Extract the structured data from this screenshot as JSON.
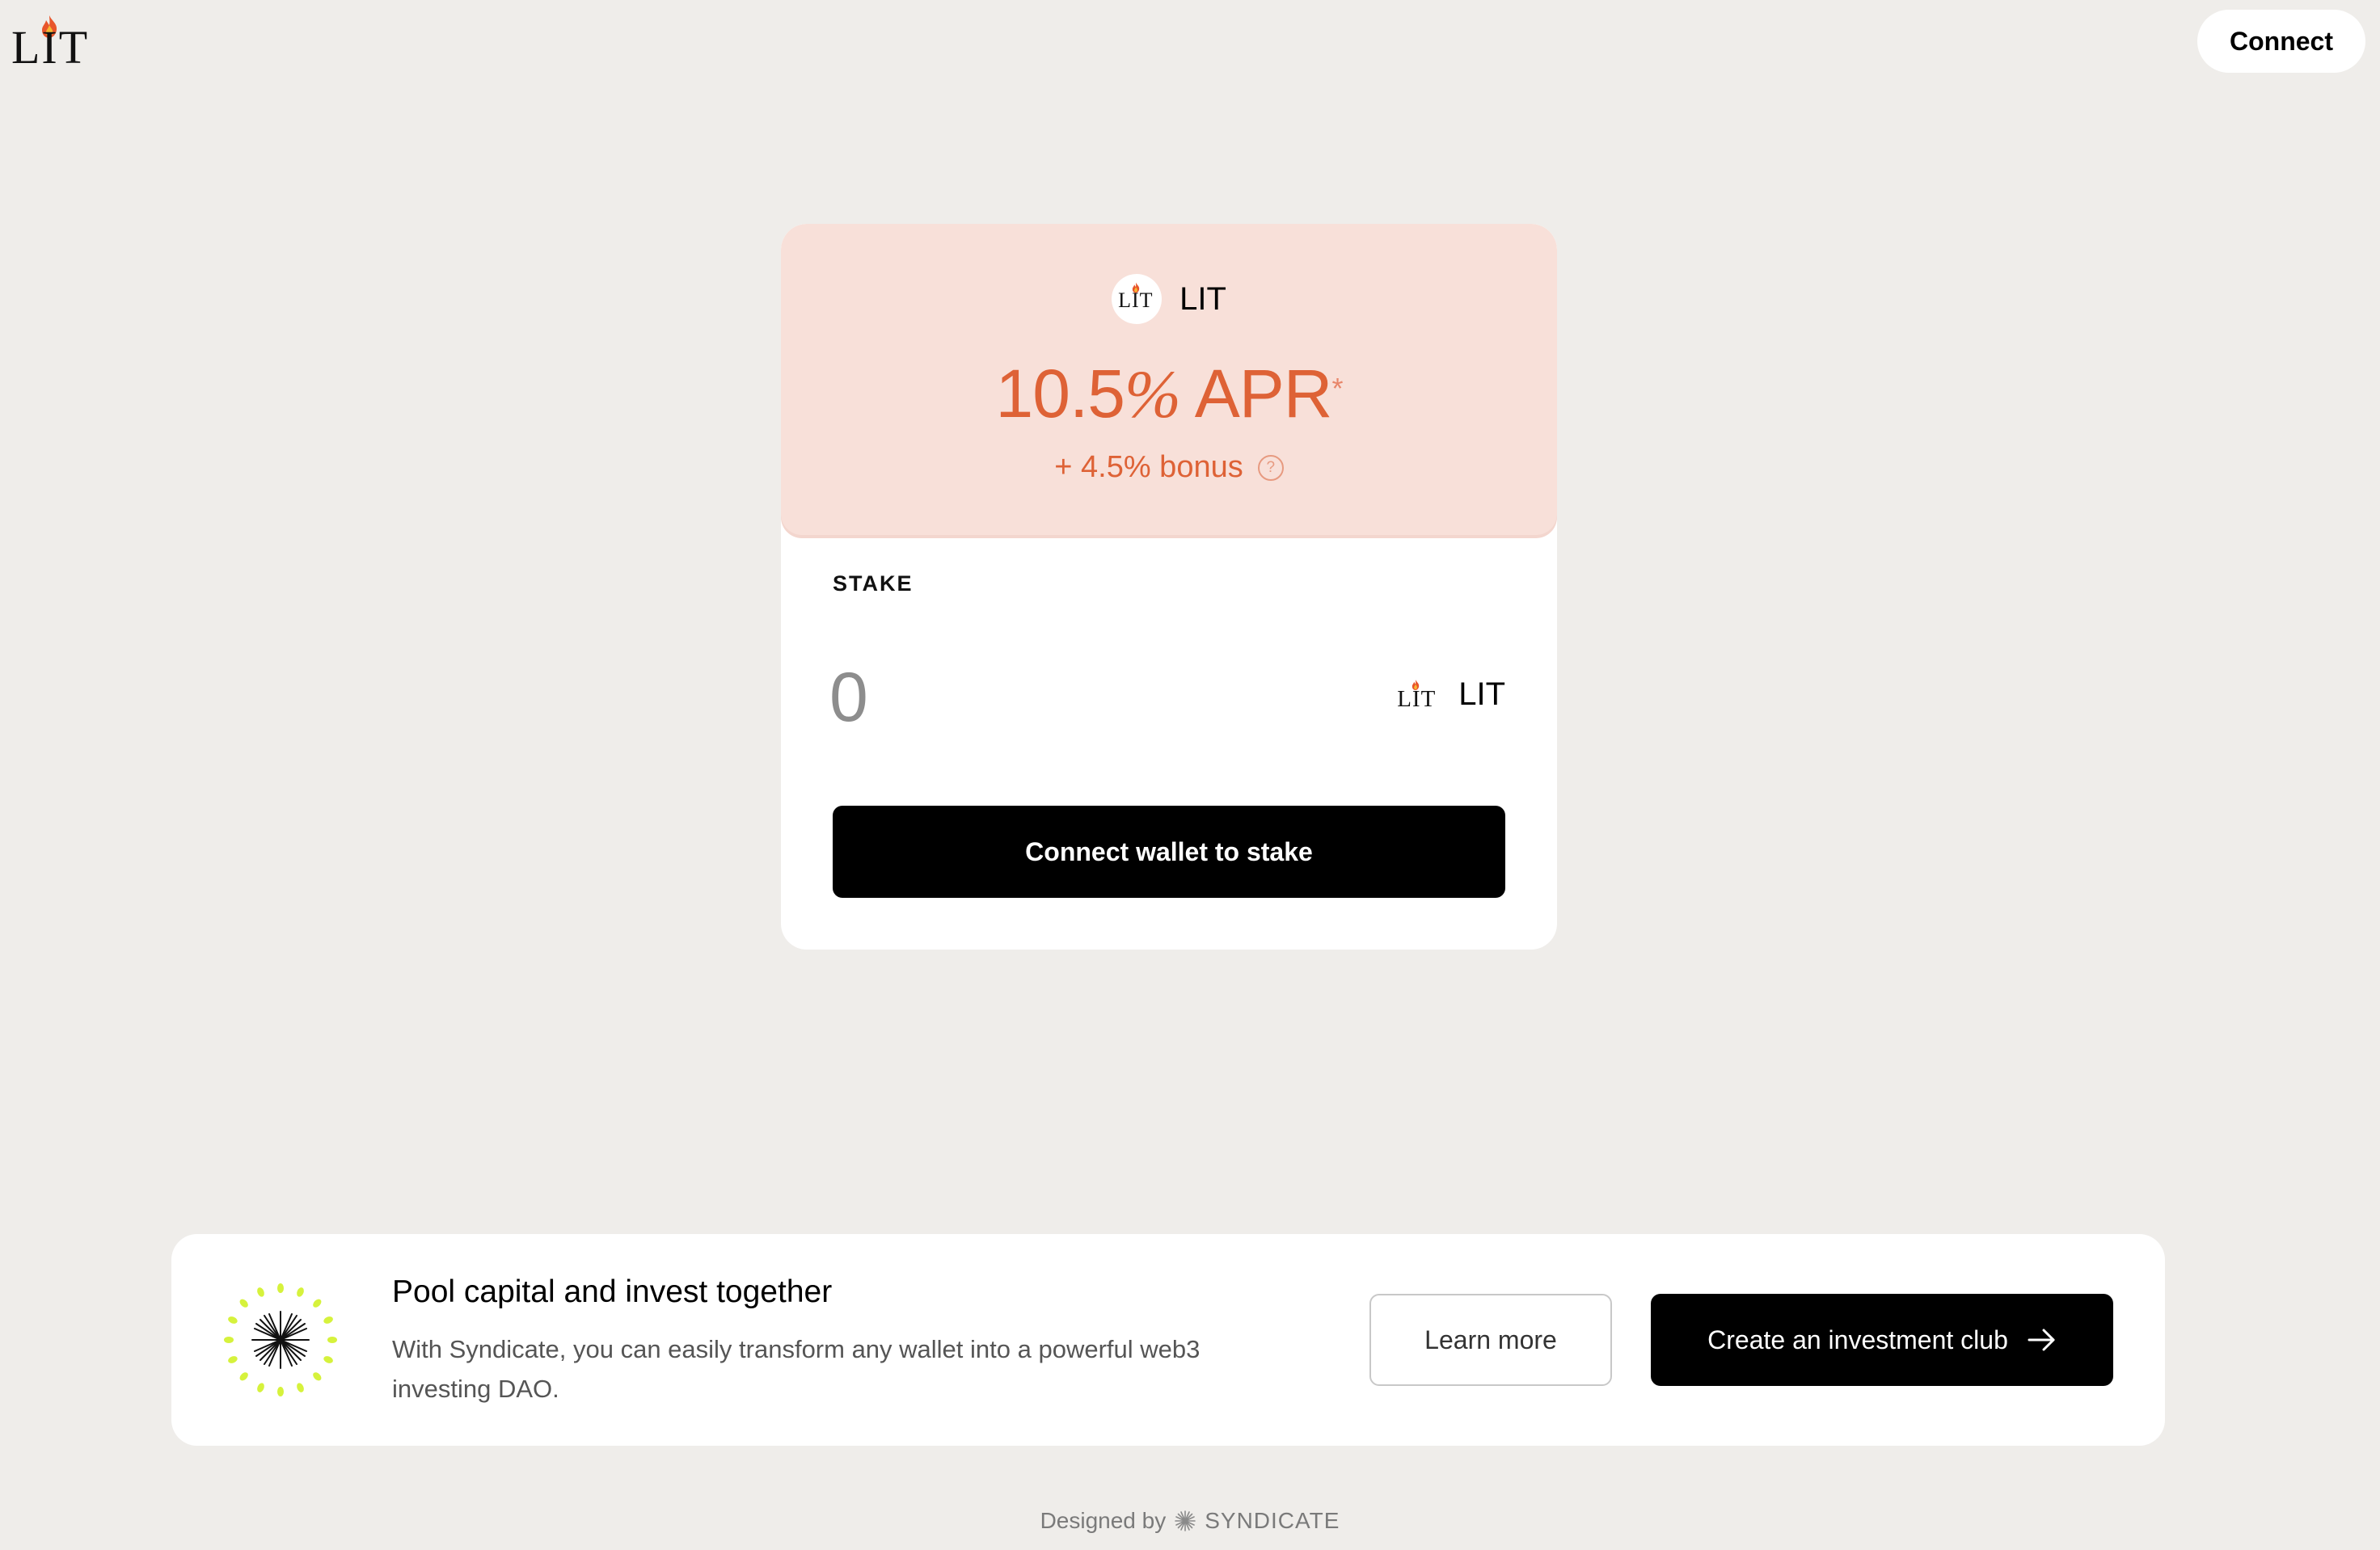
{
  "header": {
    "logo_text": "LIT",
    "connect_label": "Connect"
  },
  "stake_card": {
    "token_name": "LIT",
    "apr_number": "10.5",
    "apr_percent": "%",
    "apr_suffix": " APR",
    "apr_footnote": "*",
    "bonus_text": "+ 4.5% bonus",
    "help_symbol": "?",
    "stake_label": "STAKE",
    "amount_placeholder": "0",
    "unit_token_name": "LIT",
    "stake_button_label": "Connect wallet to stake"
  },
  "promo": {
    "title": "Pool capital and invest together",
    "description": "With Syndicate, you can easily transform any wallet into a powerful web3 investing DAO.",
    "learn_more_label": "Learn more",
    "create_label": "Create an investment club"
  },
  "footer": {
    "prefix": "Designed by",
    "brand": "SYNDICATE"
  },
  "icons": {
    "logo": "lit-flame-logo-icon",
    "help": "question-circle-icon",
    "promo": "syndicate-starburst-icon",
    "arrow": "arrow-right-icon"
  },
  "colors": {
    "background": "#efedea",
    "apr_panel": "#f8e0d9",
    "accent": "#de6236",
    "flame": "#e8552b",
    "promo_dots": "#d6f23c"
  }
}
